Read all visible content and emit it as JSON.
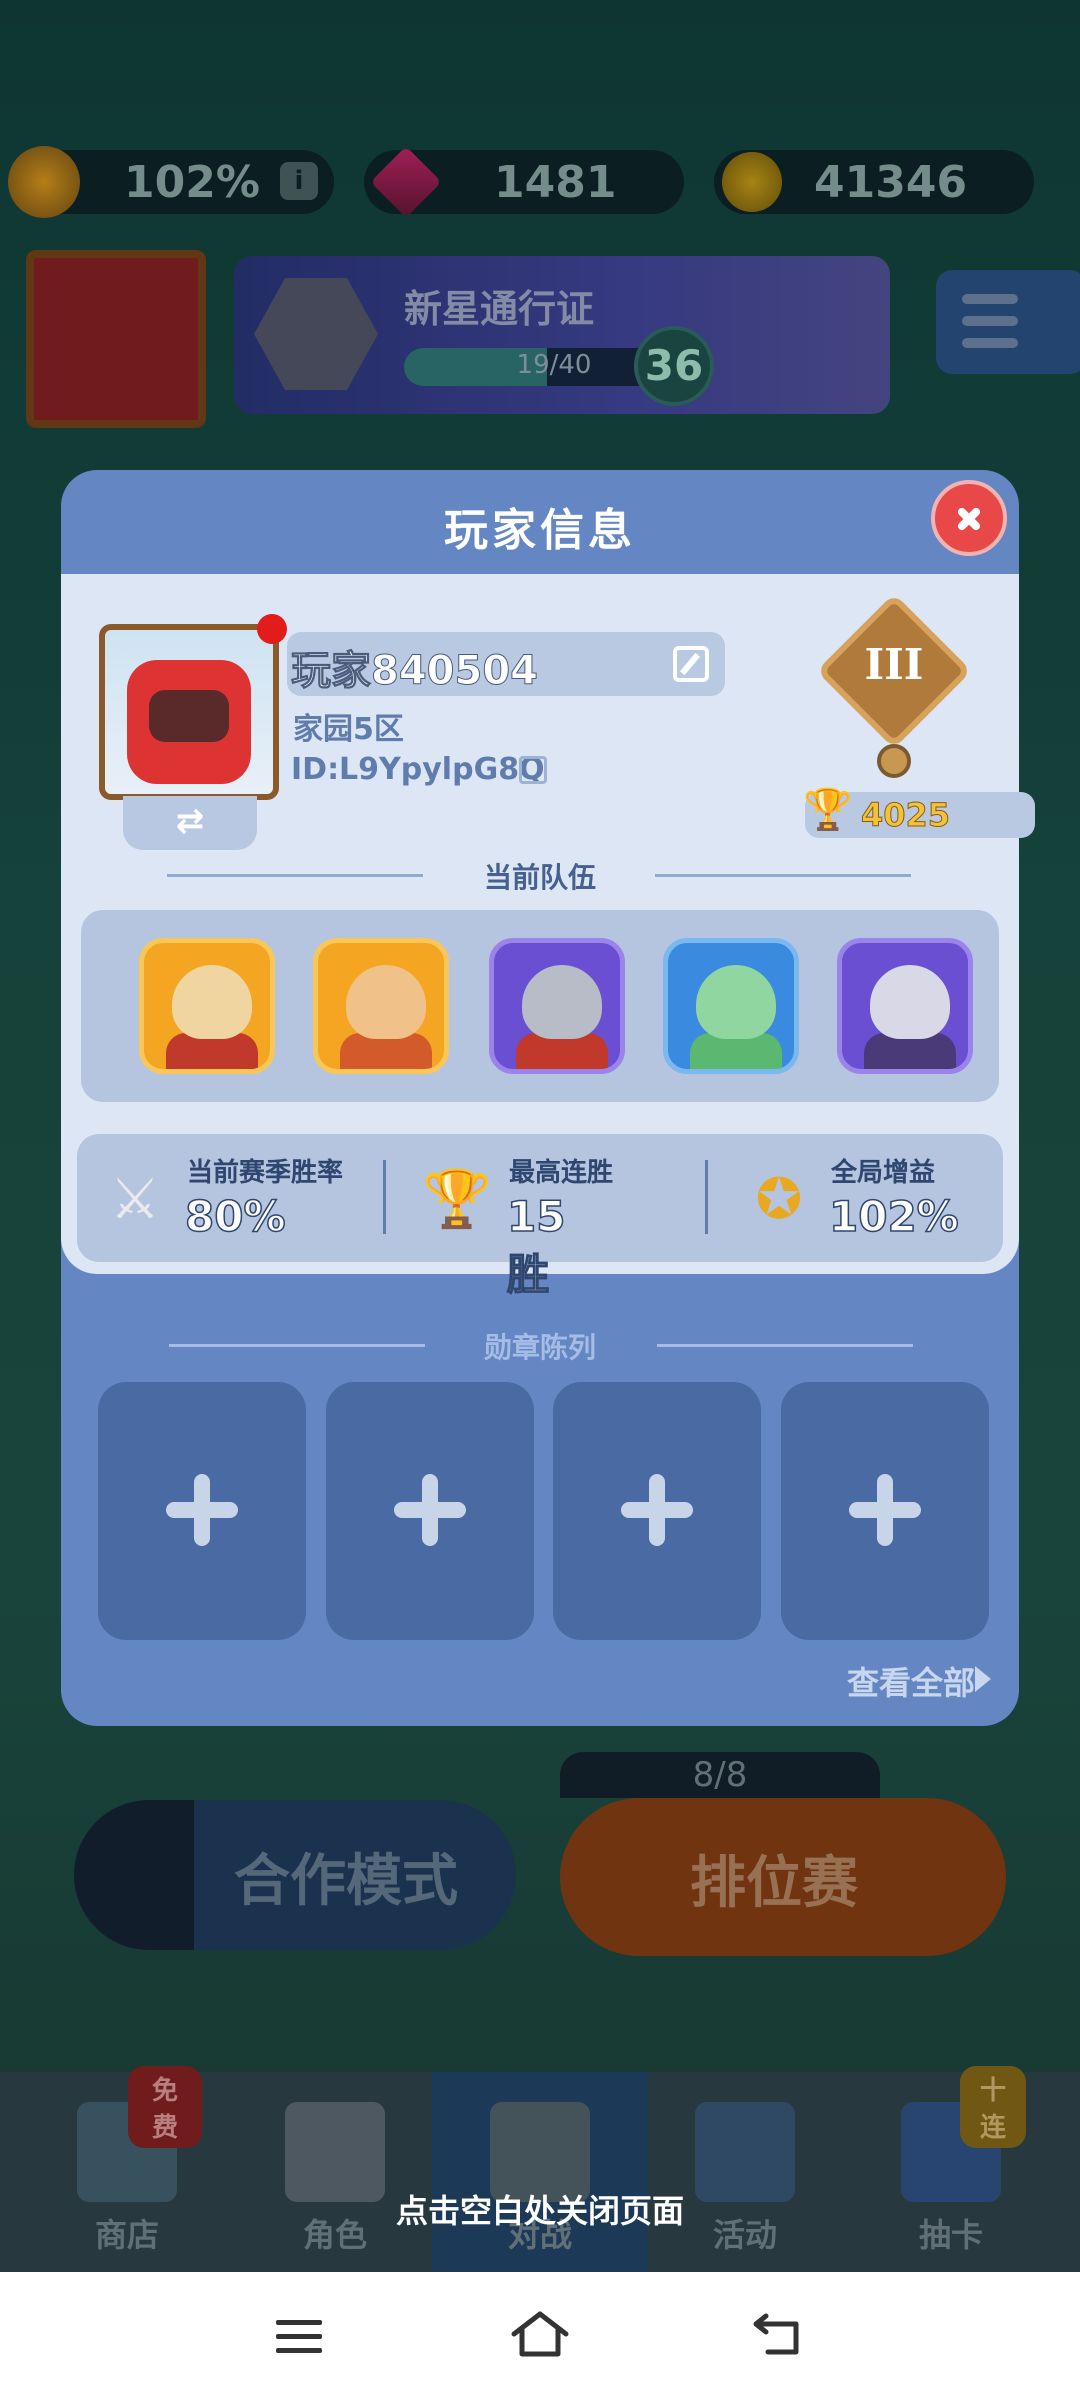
{
  "resources": {
    "energy_value": "102%",
    "gem_value": "1481",
    "coin_value": "41346"
  },
  "pass": {
    "title": "新星通行证",
    "progress_text": "19/40",
    "progress_fraction": 0.475,
    "level": "36"
  },
  "modal": {
    "title": "玩家信息",
    "player_name": "玩家840504",
    "server": "家园5区",
    "player_id": "ID:L9YpylpG8Q",
    "rank_roman": "III",
    "trophies": "4025",
    "team_section_title": "当前队伍",
    "team_heroes": [
      "hero-1",
      "hero-2",
      "hero-3",
      "hero-4",
      "hero-5"
    ],
    "stats": [
      {
        "label": "当前赛季胜率",
        "value": "80%",
        "icon": "crossed-swords-icon"
      },
      {
        "label": "最高连胜",
        "value": "15胜",
        "icon": "trophy-icon"
      },
      {
        "label": "全局增益",
        "value": "102%",
        "icon": "boost-medal-icon"
      }
    ],
    "badge_section_title": "勋章陈列",
    "badge_slots": 4,
    "view_all": "查看全部"
  },
  "background": {
    "coop_mode": "合作模式",
    "ranked": "排位赛",
    "ranked_count": "8/8",
    "nav": [
      {
        "label": "商店",
        "badge": "免费"
      },
      {
        "label": "角色",
        "badge": ""
      },
      {
        "label": "对战",
        "badge": ""
      },
      {
        "label": "活动",
        "badge": ""
      },
      {
        "label": "抽卡",
        "badge": "十连"
      }
    ]
  },
  "close_hint": "点击空白处关闭页面"
}
